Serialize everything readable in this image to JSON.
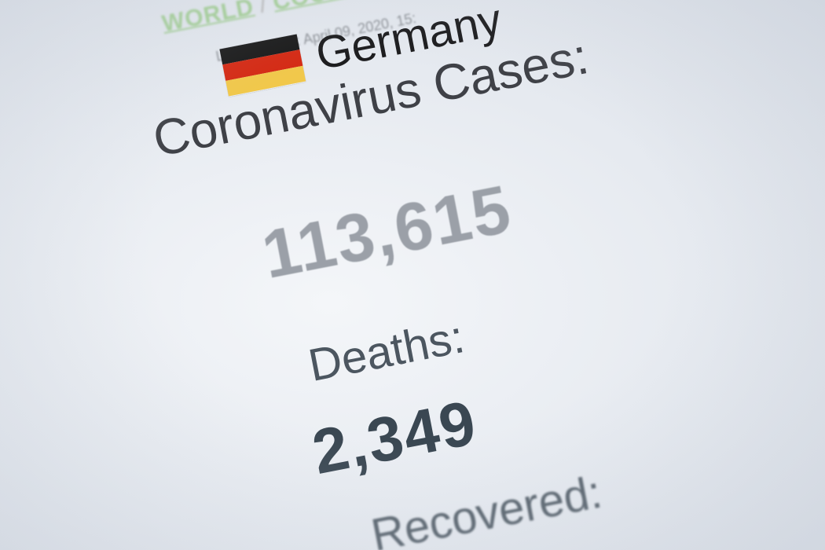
{
  "breadcrumb": {
    "world": "WORLD",
    "separator": "/",
    "countries": "COUNTRIES"
  },
  "last_updated": "Last updated: April 09, 2020, 15:",
  "country": {
    "name": "Germany",
    "flag_icon": "germany-flag-icon",
    "flag_colors": [
      "#1a1a1a",
      "#d52a14",
      "#f1c84b"
    ]
  },
  "stats": {
    "cases_label": "Coronavirus Cases:",
    "cases_value": "113,615",
    "deaths_label": "Deaths:",
    "deaths_value": "2,349",
    "recovered_label": "Recovered:"
  }
}
